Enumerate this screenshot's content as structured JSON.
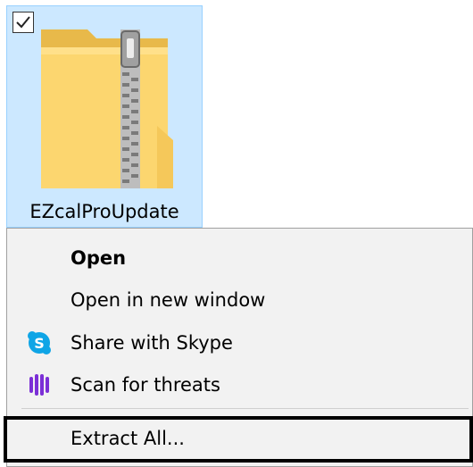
{
  "file": {
    "name": "EZcalProUpdate",
    "selected": true,
    "icon": "zip-folder-icon",
    "colors": {
      "selection_bg": "#cce8ff",
      "selection_border": "#99d1ff"
    }
  },
  "context_menu": {
    "items": [
      {
        "label": "Open",
        "bold": true,
        "icon": null
      },
      {
        "label": "Open in new window",
        "bold": false,
        "icon": null
      },
      {
        "label": "Share with Skype",
        "bold": false,
        "icon": "skype-icon"
      },
      {
        "label": "Scan for threats",
        "bold": false,
        "icon": "scan-shield-icon"
      },
      {
        "label": "Extract All...",
        "bold": false,
        "icon": null,
        "highlighted": true
      }
    ],
    "colors": {
      "background": "#f2f2f2",
      "skype": "#0fa5e6",
      "scan": "#7b2fd6"
    }
  }
}
